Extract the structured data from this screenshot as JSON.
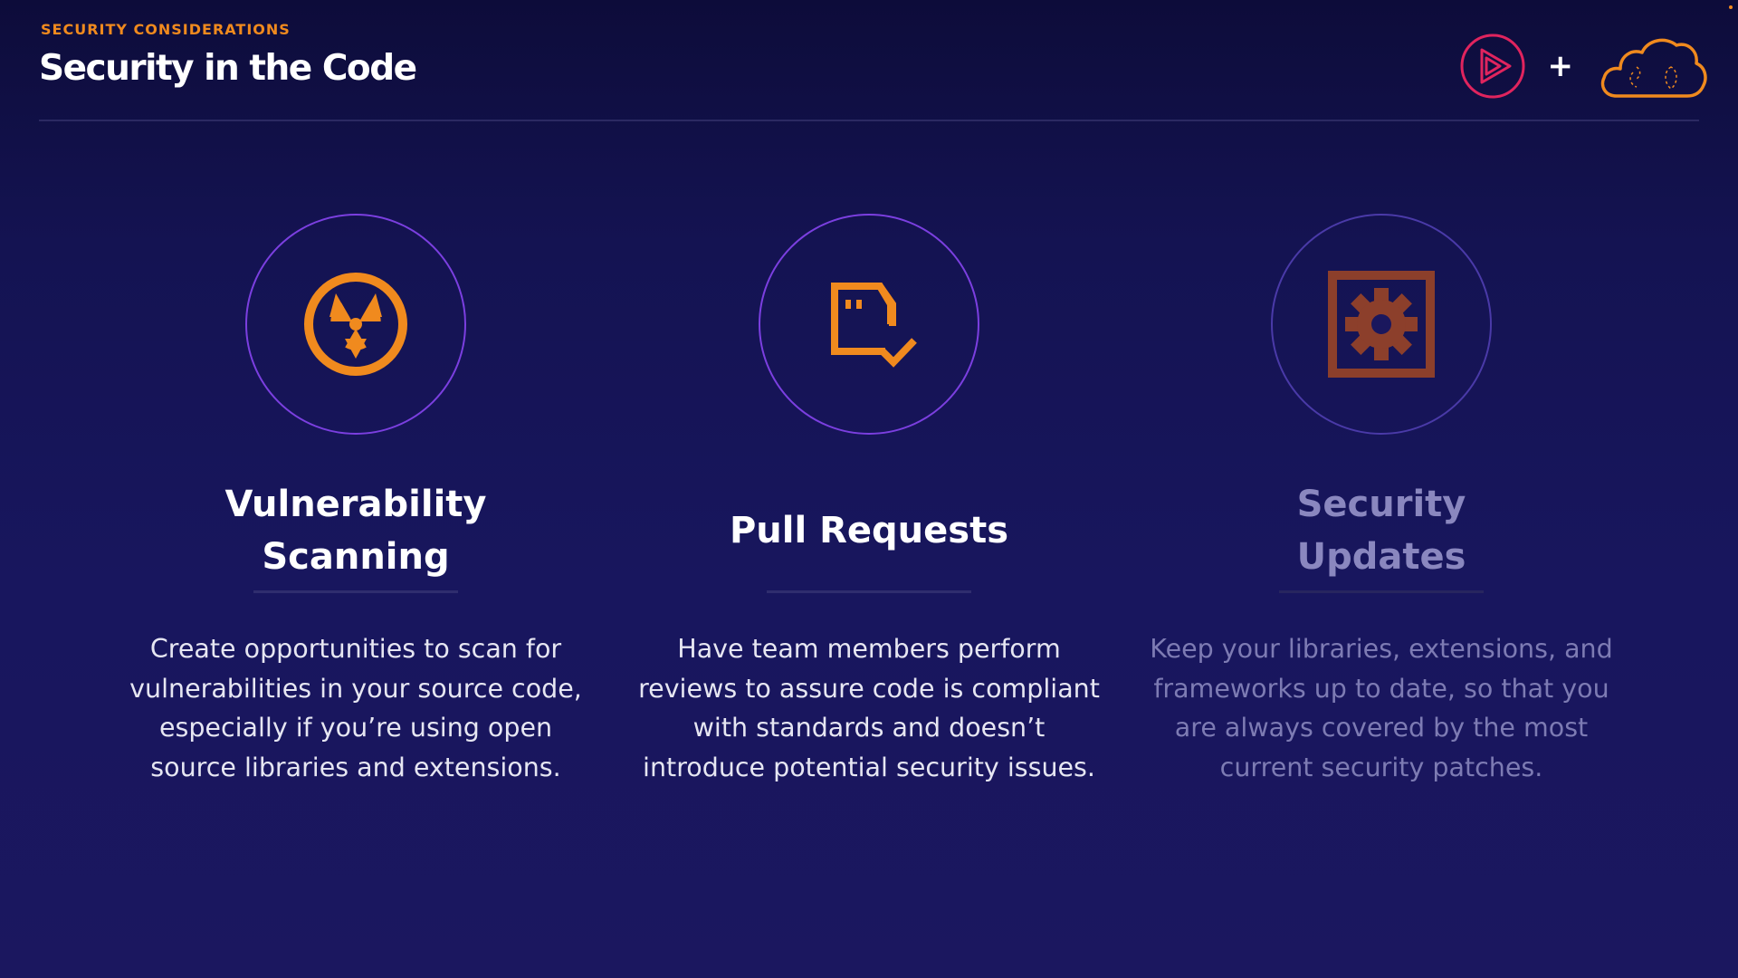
{
  "header": {
    "eyebrow": "SECURITY CONSIDERATIONS",
    "title": "Security in the Code",
    "plus": "+"
  },
  "brand": {
    "left_icon": "play-badge-icon",
    "right_icon": "cloud-icon"
  },
  "colors": {
    "accent": "#f08a1e",
    "circle_border": "#7b3fe0",
    "brand_red": "#e0245e",
    "background": "#141352"
  },
  "cards": [
    {
      "icon": "radiation-icon",
      "title": "Vulnerability Scanning",
      "text": "Create opportunities to scan for\nvulnerabilities in your source code,\nespecially if you’re using open\nsource libraries and extensions."
    },
    {
      "icon": "document-check-icon",
      "title": "Pull Requests",
      "text": "Have team members perform\nreviews to assure code is compliant\nwith standards and doesn’t\nintroduce potential security issues."
    },
    {
      "icon": "gear-box-icon",
      "title": "Security Updates",
      "text": "Keep your libraries, extensions, and\nframeworks up to date, so that you\nare always covered by the most\ncurrent security patches."
    }
  ]
}
